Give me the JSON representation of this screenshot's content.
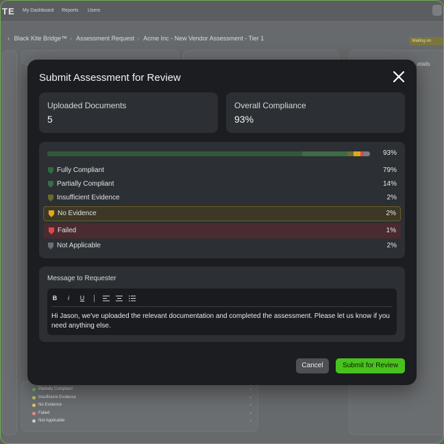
{
  "background": {
    "logo": "TE",
    "nav": [
      "My Dashboard",
      "Reports",
      "Users"
    ],
    "breadcrumb": [
      "Black Kite Bridge™",
      "Assessment Request",
      "Acme Inc - New Vendor Assessment - Tier 1"
    ],
    "status_badge": "Waiting on",
    "side_label": "etails",
    "list_items": [
      {
        "label": "Partially Compliant",
        "color": "#6fae6f"
      },
      {
        "label": "Insufficient Evidence",
        "color": "#b9c06a"
      },
      {
        "label": "No Evidence",
        "color": "#e0c85a"
      },
      {
        "label": "Failed",
        "color": "#e08a8a"
      },
      {
        "label": "Not Applicable",
        "color": "#c8c9ca"
      }
    ]
  },
  "modal": {
    "title": "Submit Assessment for Review",
    "uploaded_documents": {
      "label": "Uploaded Documents",
      "value": "5"
    },
    "overall_compliance": {
      "label": "Overall Compliance",
      "value": "93%"
    },
    "progress": {
      "total_label": "93%",
      "segments": [
        {
          "name": "Fully Compliant",
          "fraction": 0.79,
          "color": "#2f5a3a"
        },
        {
          "name": "Partially Compliant",
          "fraction": 0.14,
          "color": "#3f6b46"
        },
        {
          "name": "Insufficient Evidence",
          "fraction": 0.02,
          "color": "#6a6a3a"
        },
        {
          "name": "No Evidence",
          "fraction": 0.02,
          "color": "#e2a81c"
        },
        {
          "name": "Failed",
          "fraction": 0.01,
          "color": "#d94b4b"
        },
        {
          "name": "Not Applicable",
          "fraction": 0.02,
          "color": "#7b7d81"
        }
      ]
    },
    "rows": [
      {
        "label": "Fully Compliant",
        "pct": "79%",
        "color": "#2f6b40",
        "style": ""
      },
      {
        "label": "Partially Compliant",
        "pct": "14%",
        "color": "#3b6a47",
        "style": ""
      },
      {
        "label": "Insufficient Evidence",
        "pct": "2%",
        "color": "#6a6a2e",
        "style": ""
      },
      {
        "label": "No Evidence",
        "pct": "2%",
        "color": "#e2a81c",
        "style": "noev"
      },
      {
        "label": "Failed",
        "pct": "1%",
        "color": "#e04848",
        "style": "failed"
      },
      {
        "label": "Not Applicable",
        "pct": "2%",
        "color": "#6e7074",
        "style": ""
      }
    ],
    "message": {
      "label": "Message to Requester",
      "toolbar": {
        "bold": "B",
        "italic": "i",
        "underline": "U"
      },
      "text": "Hi Jason, we've uploaded the relevant documentation and completed the assessment. Please let us know if you need anything else."
    },
    "cancel_label": "Cancel",
    "submit_label": "Submit for Review"
  }
}
